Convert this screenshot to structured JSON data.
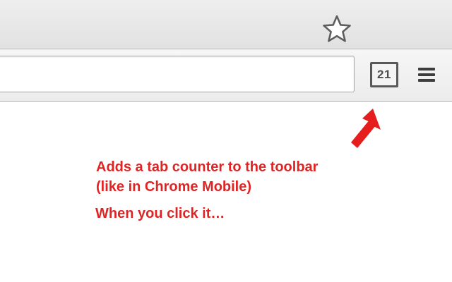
{
  "browser": {
    "omnibox": {
      "value": "",
      "placeholder": ""
    },
    "icons": {
      "bookmark": "star-outline-icon",
      "menu": "hamburger-menu-icon"
    },
    "tab_counter": {
      "count": "21"
    }
  },
  "annotation": {
    "line1": "Adds a tab counter to the toolbar",
    "line2": "(like in Chrome Mobile)",
    "line3": "When you click it…",
    "arrow": "red-arrow-icon"
  },
  "colors": {
    "annotation_red": "#e02424",
    "icon_gray": "#4f4f4f",
    "tabstrip_bg": "#e6e6e6",
    "toolbar_bg": "#f1f1f1"
  }
}
